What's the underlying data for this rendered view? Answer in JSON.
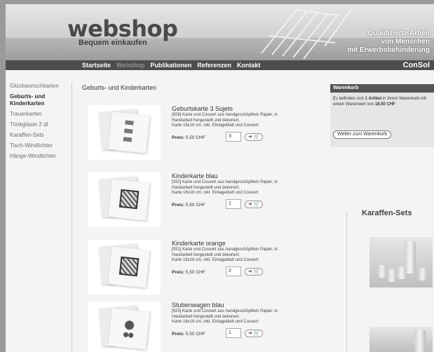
{
  "header": {
    "logo": "webshop",
    "logo_sub": "Bequem einkaufen",
    "tagline_lines": [
      "Qualifizierte Arbeit",
      "von Menschen",
      "mit Erwerbsbehinderung"
    ],
    "brand": "ConSol"
  },
  "nav": {
    "items": [
      {
        "label": "Startseite",
        "active": false
      },
      {
        "label": "Webshop",
        "active": true
      },
      {
        "label": "Publikationen",
        "active": false
      },
      {
        "label": "Referenzen",
        "active": false
      },
      {
        "label": "Kontakt",
        "active": false
      }
    ]
  },
  "sidebar": {
    "items": [
      {
        "label": "Glückwunschkarten",
        "current": false
      },
      {
        "label": "Geburts- und Kinderkarten",
        "current": true
      },
      {
        "label": "Trauerkarten",
        "current": false
      },
      {
        "label": "Trinkgläser 2 dl",
        "current": false
      },
      {
        "label": "Karaffen-Sets",
        "current": false
      },
      {
        "label": "Tisch-Windlichter",
        "current": false
      },
      {
        "label": "Hänge-Windlichter",
        "current": false
      }
    ]
  },
  "main": {
    "title": "Geburts- und Kinderkarten",
    "price_label": "Preis:",
    "add_button": "➜ 🛒",
    "products": [
      {
        "name": "Geburtskarte 3 Sujets",
        "desc_lines": [
          "[928] Karte und Couvert aus handgeschöpftem Papier, in",
          "Handarbeit hergestellt und dekoriert.",
          "Karte 16x16 cm, inkl. Einlageblatt und Couvert"
        ],
        "price": "5.50 CHF",
        "qty": "3",
        "motif": "small"
      },
      {
        "name": "Kinderkarte blau",
        "desc_lines": [
          "[932] Karte und Couvert aus handgeschöpftem Papier, in",
          "Handarbeit hergestellt und dekoriert.",
          "Karte 16x16 cm, inkl. Einlageblatt und Couvert"
        ],
        "price": "5.50 CHF",
        "qty": "1",
        "motif": "pattern"
      },
      {
        "name": "Kinderkarte orange",
        "desc_lines": [
          "[931] Karte und Couvert aus handgeschöpftem Papier, in",
          "Handarbeit hergestellt und dekoriert.",
          "Karte 16x16 cm, inkl. Einlageblatt und Couvert"
        ],
        "price": "5.50 CHF",
        "qty": "2",
        "motif": "pattern"
      },
      {
        "name": "Stubenwagen blau",
        "desc_lines": [
          "[925] Karte und Couvert aus handgeschöpftem Papier, in",
          "Handarbeit hergestellt und dekoriert.",
          "Karte 16x16 cm, inkl. Einlageblatt und Couvert"
        ],
        "price": "5.50 CHF",
        "qty": "1",
        "motif": "carriage"
      }
    ]
  },
  "cart": {
    "title": "Warenkorb",
    "text_before": "Es befinden sich ",
    "count_text": "1 Artikel",
    "text_after": " in Ihrem Warenkorb mit einem Warenwert von ",
    "total": "18.50 CHF",
    "button": "Weiter zum Warenkorb"
  },
  "promo": {
    "title": "Karaffen-Sets"
  }
}
